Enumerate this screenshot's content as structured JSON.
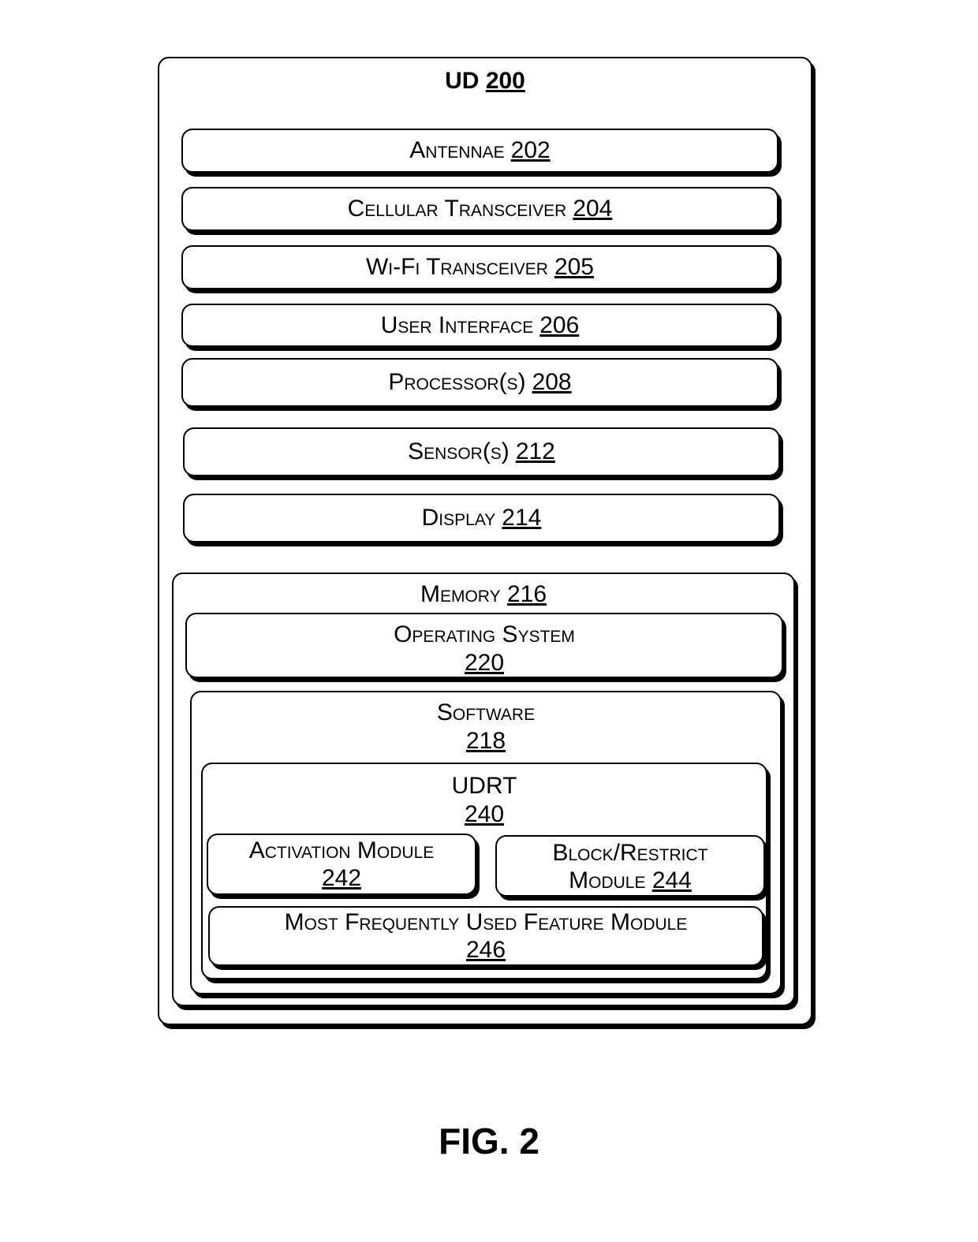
{
  "title": {
    "name": "UD",
    "num": "200"
  },
  "components": [
    {
      "name": "Antennae",
      "num": "202"
    },
    {
      "name": "Cellular Transceiver",
      "num": "204"
    },
    {
      "name": "Wi-Fi Transceiver",
      "num": "205"
    },
    {
      "name": "User Interface",
      "num": "206"
    },
    {
      "name": "Processor(s)",
      "num": "208"
    },
    {
      "name": "Sensor(s)",
      "num": "212"
    },
    {
      "name": "Display",
      "num": "214"
    }
  ],
  "memory": {
    "name": "Memory",
    "num": "216"
  },
  "os": {
    "name": "Operating System",
    "num": "220"
  },
  "software": {
    "name": "Software",
    "num": "218"
  },
  "udrt": {
    "name": "UDRT",
    "num": "240"
  },
  "activation": {
    "name": "Activation Module",
    "num": "242"
  },
  "block": {
    "line1": "Block/Restrict",
    "line2": "Module",
    "num": "244"
  },
  "mfu": {
    "name": "Most Frequently Used Feature Module",
    "num": "246"
  },
  "figure": "FIG. 2"
}
